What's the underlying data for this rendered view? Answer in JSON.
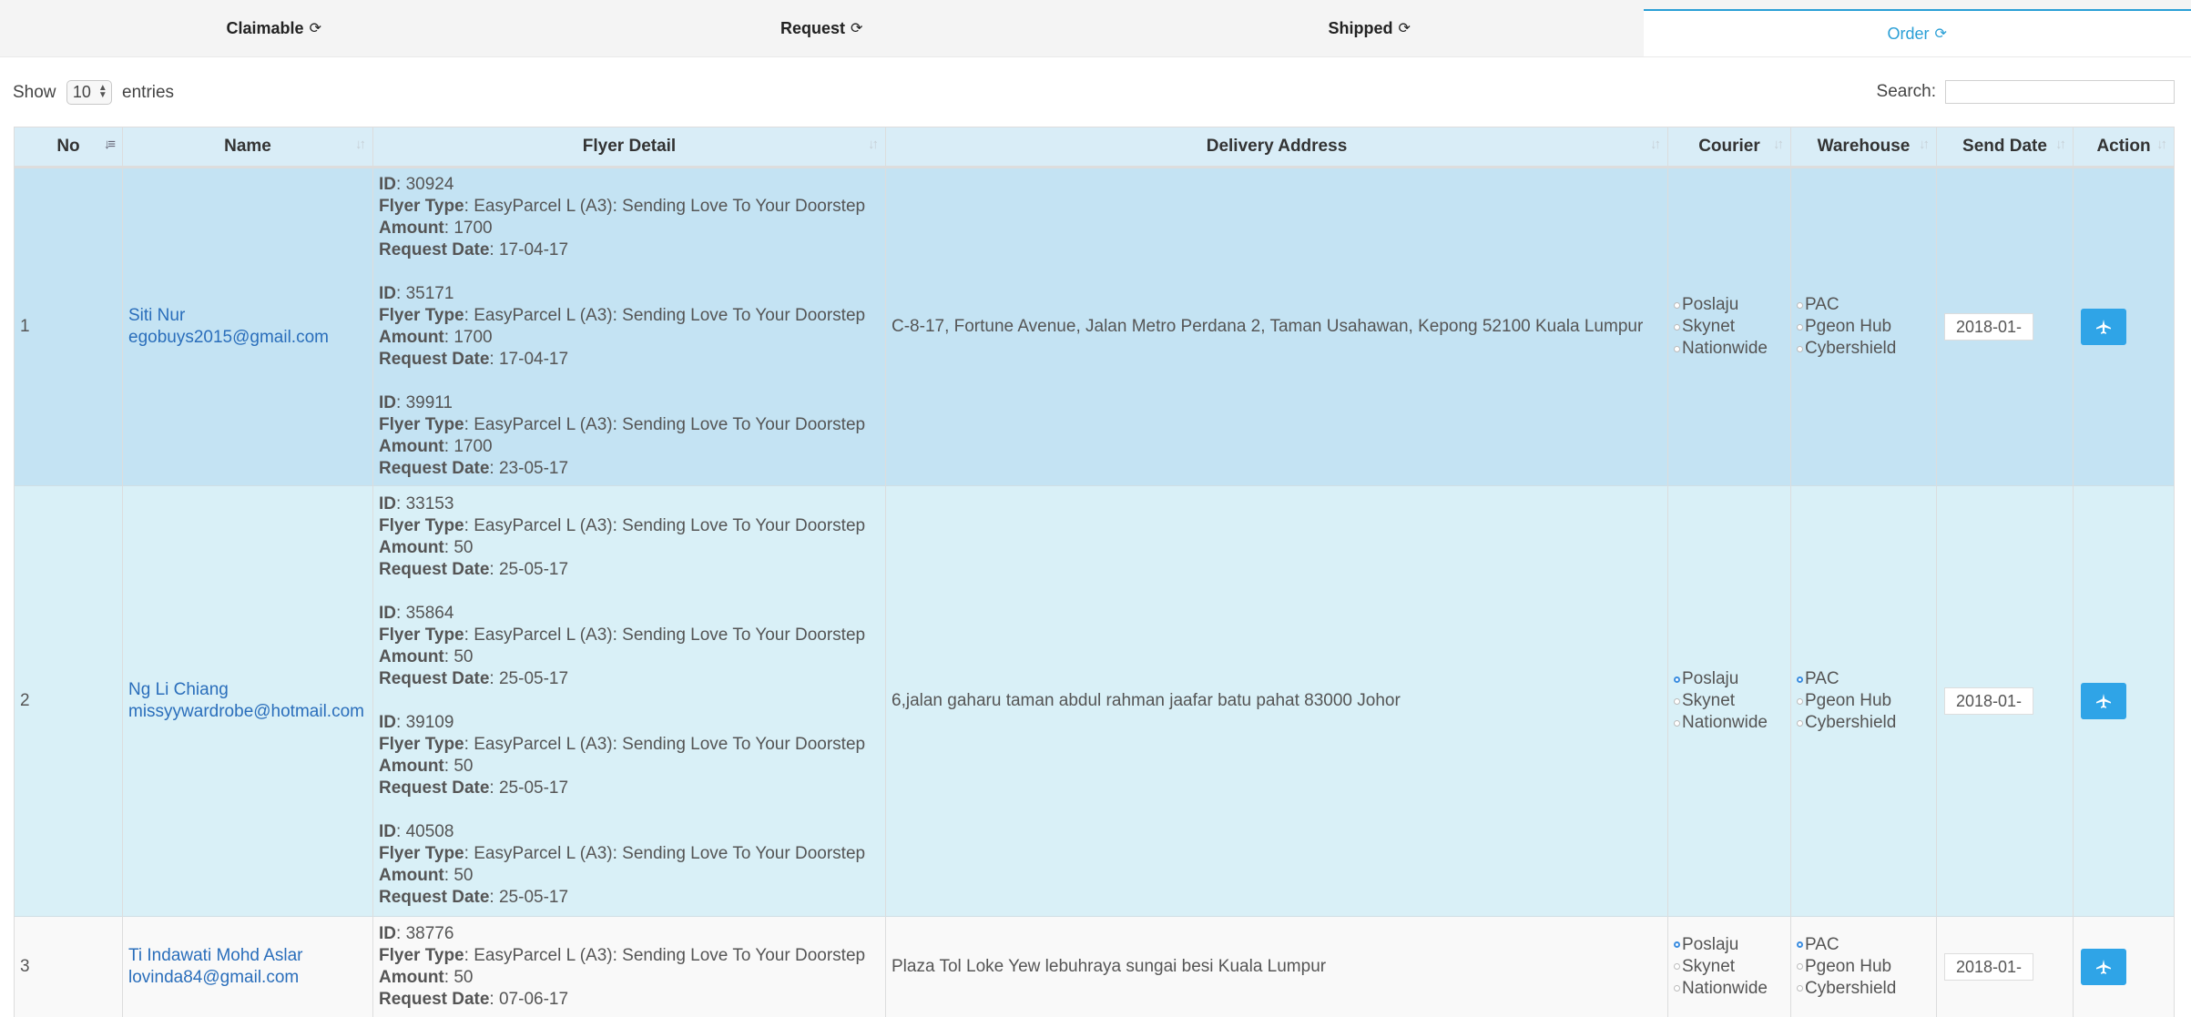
{
  "tabs": [
    {
      "label": "Claimable",
      "active": false
    },
    {
      "label": "Request",
      "active": false
    },
    {
      "label": "Shipped",
      "active": false
    },
    {
      "label": "Order",
      "active": true
    }
  ],
  "refresh_glyph": "⟳",
  "controls": {
    "show_label": "Show",
    "entries_value": "10",
    "entries_label": "entries",
    "search_label": "Search:",
    "search_value": ""
  },
  "columns": [
    "No",
    "Name",
    "Flyer Detail",
    "Delivery Address",
    "Courier",
    "Warehouse",
    "Send Date",
    "Action"
  ],
  "labels": {
    "id": "ID",
    "flyer_type": "Flyer Type",
    "amount": "Amount",
    "request_date": "Request Date"
  },
  "courier_options": [
    "Poslaju",
    "Skynet",
    "Nationwide"
  ],
  "warehouse_options": [
    "PAC",
    "Pgeon Hub",
    "Cybershield"
  ],
  "rows": [
    {
      "no": "1",
      "name": "Siti Nur",
      "email": "egobuys2015@gmail.com",
      "flyers": [
        {
          "id": "30924",
          "type": "EasyParcel L (A3): Sending Love To Your Doorstep",
          "amount": "1700",
          "date": "17-04-17"
        },
        {
          "id": "35171",
          "type": "EasyParcel L (A3): Sending Love To Your Doorstep",
          "amount": "1700",
          "date": "17-04-17"
        },
        {
          "id": "39911",
          "type": "EasyParcel L (A3): Sending Love To Your Doorstep",
          "amount": "1700",
          "date": "23-05-17"
        }
      ],
      "address": "C-8-17, Fortune Avenue, Jalan Metro Perdana 2, Taman Usahawan, Kepong 52100 Kuala Lumpur",
      "courier_selected": "",
      "warehouse_selected": "",
      "send_date": "2018-01-"
    },
    {
      "no": "2",
      "name": "Ng Li Chiang",
      "email": "missyywardrobe@hotmail.com",
      "flyers": [
        {
          "id": "33153",
          "type": "EasyParcel L (A3): Sending Love To Your Doorstep",
          "amount": "50",
          "date": "25-05-17"
        },
        {
          "id": "35864",
          "type": "EasyParcel L (A3): Sending Love To Your Doorstep",
          "amount": "50",
          "date": "25-05-17"
        },
        {
          "id": "39109",
          "type": "EasyParcel L (A3): Sending Love To Your Doorstep",
          "amount": "50",
          "date": "25-05-17"
        },
        {
          "id": "40508",
          "type": "EasyParcel L (A3): Sending Love To Your Doorstep",
          "amount": "50",
          "date": "25-05-17"
        }
      ],
      "address": "6,jalan gaharu taman abdul rahman jaafar batu pahat 83000 Johor",
      "courier_selected": "Poslaju",
      "warehouse_selected": "PAC",
      "send_date": "2018-01-"
    },
    {
      "no": "3",
      "name": "Ti Indawati Mohd Aslar",
      "email": "lovinda84@gmail.com",
      "flyers": [
        {
          "id": "38776",
          "type": "EasyParcel L (A3): Sending Love To Your Doorstep",
          "amount": "50",
          "date": "07-06-17"
        }
      ],
      "address": "Plaza Tol Loke Yew lebuhraya sungai besi Kuala Lumpur",
      "courier_selected": "Poslaju",
      "warehouse_selected": "PAC",
      "send_date": "2018-01-"
    }
  ],
  "colors": {
    "accent": "#2a9fd6",
    "header_bg": "#d9edf7",
    "row_selected": "#c4e3f3",
    "row_info": "#d9f0f7",
    "button": "#2fa4e7"
  }
}
